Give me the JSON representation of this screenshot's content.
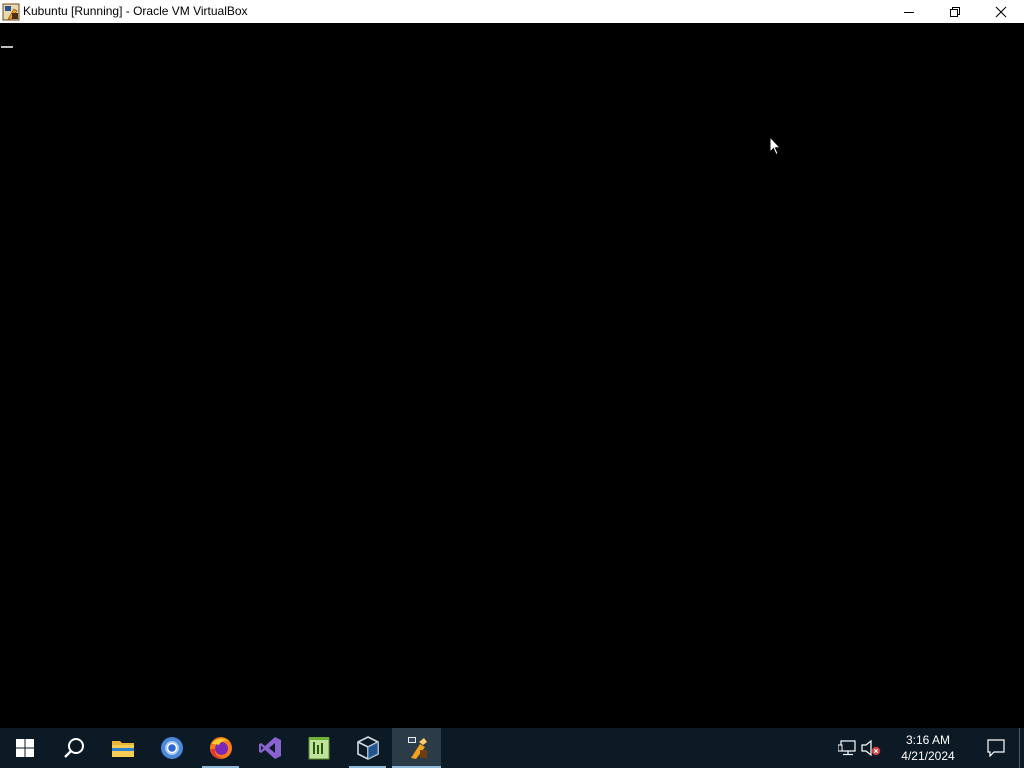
{
  "window": {
    "title": "Kubuntu [Running] - Oracle VM VirtualBox",
    "controls": [
      "minimize",
      "restore",
      "close"
    ]
  },
  "taskbar": {
    "items": [
      {
        "name": "start",
        "icon": "windows-logo-icon",
        "running": false,
        "active": false
      },
      {
        "name": "search",
        "icon": "search-icon",
        "running": false,
        "active": false
      },
      {
        "name": "file-explorer",
        "icon": "folder-icon",
        "running": false,
        "active": false
      },
      {
        "name": "chrome",
        "icon": "chrome-icon",
        "running": false,
        "active": false
      },
      {
        "name": "firefox",
        "icon": "firefox-icon",
        "running": true,
        "active": false
      },
      {
        "name": "visual-studio",
        "icon": "visual-studio-icon",
        "running": false,
        "active": false
      },
      {
        "name": "notepad-plus-plus",
        "icon": "notepad-icon",
        "running": false,
        "active": false
      },
      {
        "name": "virtualbox-manager",
        "icon": "virtualbox-icon",
        "running": true,
        "active": false
      },
      {
        "name": "virtualbox-vm",
        "icon": "vm-window-icon",
        "running": true,
        "active": true
      }
    ],
    "tray": {
      "network_icon": "network-icon",
      "volume_icon": "volume-muted-icon",
      "time": "3:16 AM",
      "date": "4/21/2024",
      "notification_icon": "action-center-icon"
    }
  },
  "colors": {
    "titlebar_bg": "#ffffff",
    "vm_bg": "#000000",
    "taskbar_bg": "#0b1a24",
    "accent": "#8eb9d8"
  }
}
